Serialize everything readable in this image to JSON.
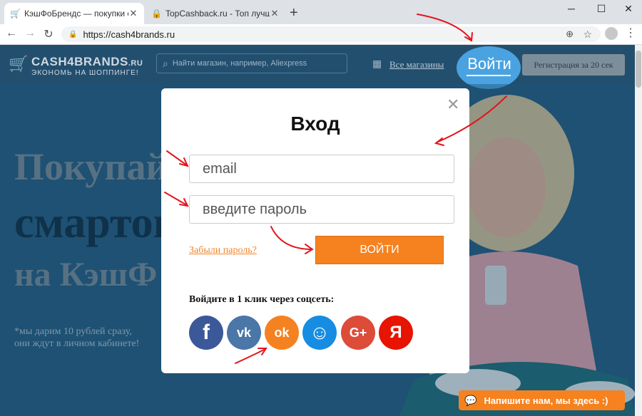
{
  "browser": {
    "tabs": [
      {
        "title": "КэшФоБрендс — покупки с кэш",
        "favicon": "cart-icon",
        "active": true
      },
      {
        "title": "TopCashback.ru - Топ лучших кэ",
        "favicon": "lock-icon",
        "active": false
      }
    ],
    "new_tab": "+",
    "controls": {
      "minimize": "─",
      "maximize": "☐",
      "close": "✕"
    },
    "url": "https://cash4brands.ru"
  },
  "site": {
    "logo": {
      "brand": "CASH4BRANDS",
      "tld": ".RU",
      "tagline": "ЭКОНОМЬ НА ШОППИНГЕ!"
    },
    "search_placeholder": "Найти магазин, например, Aliexpress",
    "all_stores": "Все магазины",
    "login": "Войти",
    "register": "Регистрация за 20 сек",
    "hero": {
      "line1": "Покупай",
      "line2": "смартон",
      "line3": "на КэшФ"
    },
    "note": {
      "line1": "*мы дарим 10 рублей сразу,",
      "line2": "они ждут в личном кабинете!"
    },
    "chat": "Напишите нам, мы здесь :)"
  },
  "modal": {
    "title": "Вход",
    "email_placeholder": "email",
    "password_placeholder": "введите пароль",
    "forgot": "Забыли пароль?",
    "submit": "ВОЙТИ",
    "social_label": "Войдите в 1 клик через соцсеть:",
    "socials": [
      {
        "name": "facebook",
        "glyph": "f",
        "color": "#3b5998"
      },
      {
        "name": "vk",
        "glyph": "vk",
        "color": "#4a76a8"
      },
      {
        "name": "odnoklassniki",
        "glyph": "ok",
        "color": "#f58220"
      },
      {
        "name": "mail.ru",
        "glyph": "☺",
        "color": "#168de2"
      },
      {
        "name": "google-plus",
        "glyph": "G+",
        "color": "#dd4b39"
      },
      {
        "name": "yandex",
        "glyph": "Я",
        "color": "#e61400"
      }
    ]
  },
  "colors": {
    "accent": "#f5821f",
    "annotation": "#e3141c"
  }
}
